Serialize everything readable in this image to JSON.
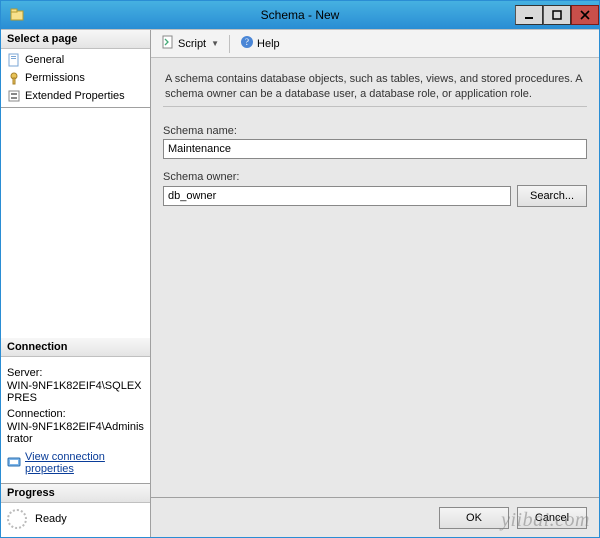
{
  "window": {
    "title": "Schema - New"
  },
  "left": {
    "select_page_heading": "Select a page",
    "pages": [
      {
        "label": "General"
      },
      {
        "label": "Permissions"
      },
      {
        "label": "Extended Properties"
      }
    ],
    "connection_heading": "Connection",
    "server_label": "Server:",
    "server_value": "WIN-9NF1K82EIF4\\SQLEXPRES",
    "connection_label": "Connection:",
    "connection_value": "WIN-9NF1K82EIF4\\Administrator",
    "view_props_link": "View connection properties",
    "progress_heading": "Progress",
    "progress_status": "Ready"
  },
  "toolbar": {
    "script_label": "Script",
    "help_label": "Help"
  },
  "main": {
    "description": "A schema contains database objects, such as tables, views, and stored procedures. A schema owner can be a database user, a database role, or application role.",
    "schema_name_label": "Schema name:",
    "schema_name_value": "Maintenance",
    "schema_owner_label": "Schema owner:",
    "schema_owner_value": "db_owner",
    "search_button": "Search..."
  },
  "footer": {
    "ok": "OK",
    "cancel": "Cancel"
  },
  "watermark": "yiibai.com"
}
